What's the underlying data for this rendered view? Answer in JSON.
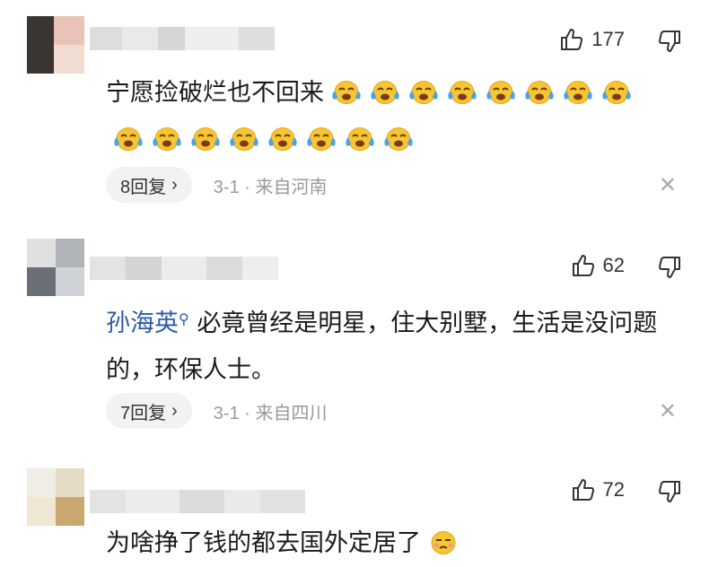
{
  "comments": [
    {
      "likes": "177",
      "text": "宁愿捡破烂也不回来",
      "emoji": "crying-face",
      "emoji_count": 16,
      "replies": "8回复",
      "date_location": "3-1 · 来自河南"
    },
    {
      "likes": "62",
      "mention": "孙海英",
      "text": "必竟曾经是明星，住大别墅，生活是没问题的，环保人士。",
      "replies": "7回复",
      "date_location": "3-1 · 来自四川"
    },
    {
      "likes": "72",
      "text": "为啥挣了钱的都去国外定居了",
      "emoji": "unamused-face"
    }
  ],
  "icons": {
    "like": "thumbs-up-icon",
    "dislike": "thumbs-down-icon",
    "close": "close-icon",
    "chevron": "chevron-right-icon",
    "search": "search-icon"
  },
  "colors": {
    "mention": "#2c5aa8",
    "meta": "#999999",
    "pill_bg": "#f2f2f2",
    "emoji_yellow": "#f7c531"
  }
}
